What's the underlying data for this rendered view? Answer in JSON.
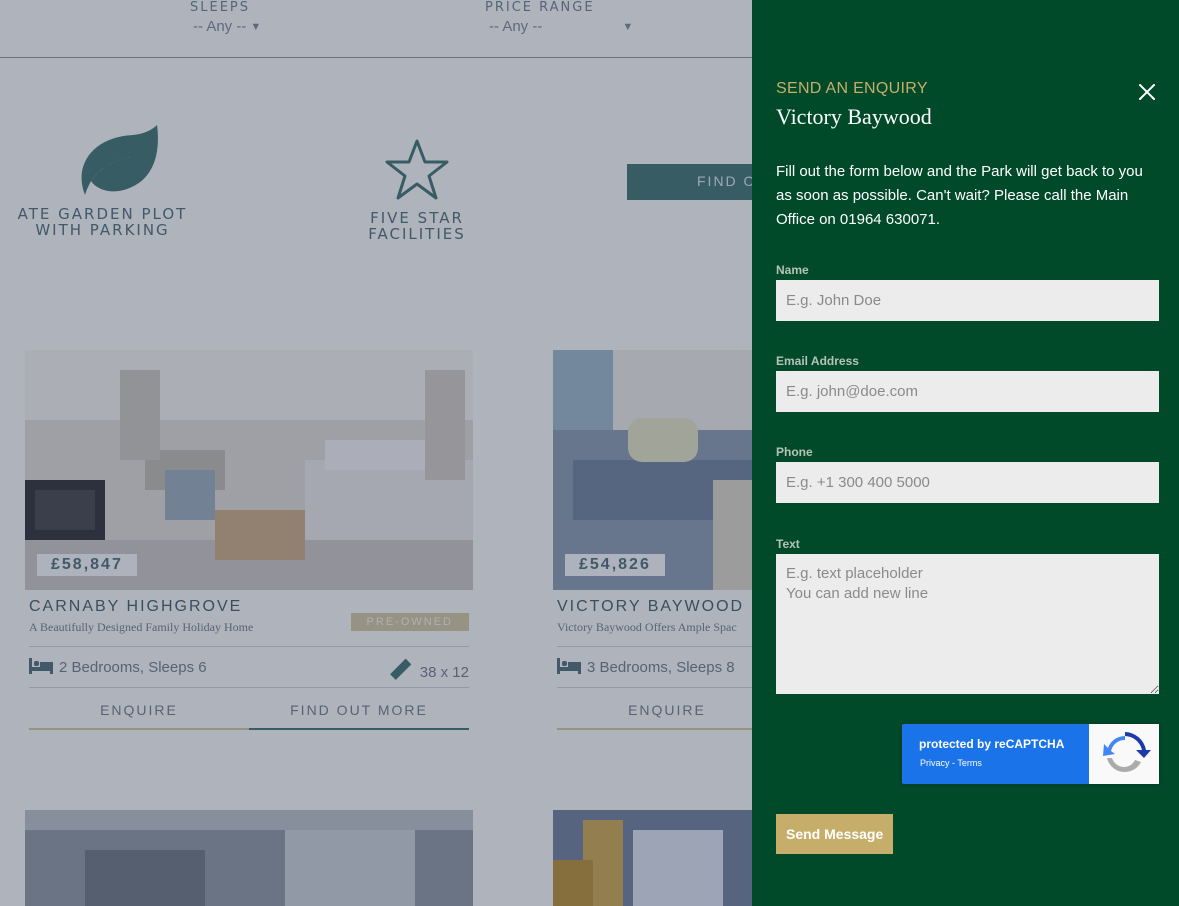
{
  "filters": {
    "sleeps": {
      "label": "SLEEPS",
      "value": "-- Any --"
    },
    "price": {
      "label": "PRICE RANGE",
      "value": "-- Any --"
    }
  },
  "features": [
    {
      "icon": "leaf-icon",
      "label": "ATE GARDEN PLOT WITH PARKING"
    },
    {
      "icon": "star-icon",
      "label": "FIVE STAR FACILITIES"
    }
  ],
  "top_button": "FIND OU",
  "cards": [
    {
      "price": "£58,847",
      "title": "CARNABY HIGHGROVE",
      "subtitle": "A Beautifully Designed Family Holiday Home",
      "tag": "PRE-OWNED",
      "beds": "2 Bedrooms, Sleeps 6",
      "size": "38 x 12",
      "enquire": "ENQUIRE",
      "more": "FIND OUT MORE"
    },
    {
      "price": "£54,826",
      "title": "VICTORY BAYWOOD",
      "subtitle": "Victory Baywood Offers Ample Spac",
      "beds": "3 Bedrooms, Sleeps 8",
      "enquire": "ENQUIRE"
    }
  ],
  "panel": {
    "eyebrow": "SEND AN ENQUIRY",
    "title": "Victory Baywood",
    "intro": "Fill out the form below and the Park will get back to you as soon as possible. Can't wait? Please call the Main Office on 01964 630071.",
    "fields": {
      "name": {
        "label": "Name",
        "placeholder": "E.g. John Doe"
      },
      "email": {
        "label": "Email Address",
        "placeholder": "E.g. john@doe.com"
      },
      "phone": {
        "label": "Phone",
        "placeholder": "E.g. +1 300 400 5000"
      },
      "text": {
        "label": "Text",
        "placeholder": "E.g. text placeholder\nYou can add new line"
      }
    },
    "recaptcha": {
      "text": "protected by reCAPTCHA",
      "links": "Privacy - Terms"
    },
    "submit": "Send Message"
  },
  "colors": {
    "panel_bg": "#004a2a",
    "accent_gold": "#c6ae6a",
    "teal": "#3f6f6a",
    "recaptcha_blue": "#1a73e8"
  }
}
